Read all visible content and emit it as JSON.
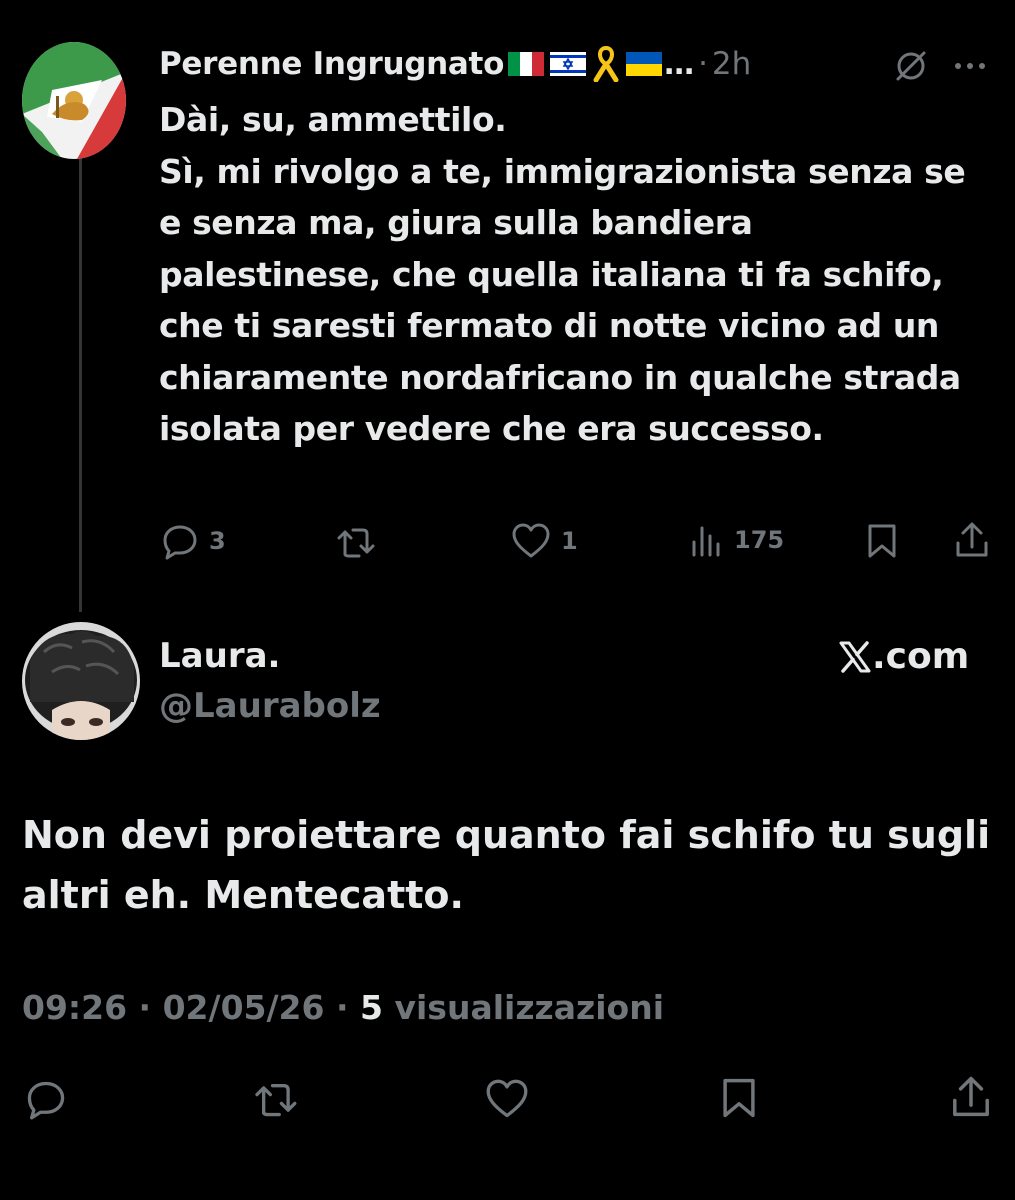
{
  "parent": {
    "author_name": "Perenne Ingrugnato",
    "name_ellipsis": "…",
    "separator": "·",
    "time": "2h",
    "body": "Dài, su, ammettilo.\nSì, mi rivolgo a te, immigrazionista senza se e senza ma, giura sulla bandiera palestinese, che quella italiana ti fa schifo, che ti saresti fermato di notte vicino ad un chiaramente nordafricano in qualche strada isolata per vedere che era successo.",
    "actions": {
      "replies": "3",
      "retweets": "",
      "likes": "1",
      "views": "175"
    },
    "icons": [
      "grok-icon",
      "more-icon",
      "reply-icon",
      "retweet-icon",
      "like-icon",
      "views-icon",
      "bookmark-icon",
      "share-icon"
    ]
  },
  "reply": {
    "author_name": "Laura.",
    "handle": "@Laurabolz",
    "source": ".com",
    "body": "Non devi proiettare quanto fai schifo tu sugli altri eh. Mentecatto.",
    "time": "09:26",
    "sep1": "·",
    "date": "02/05/26",
    "sep2": "·",
    "view_count": "5",
    "view_label": "visualizzazioni"
  },
  "colors": {
    "background": "#000000",
    "text_primary": "#e7e9ea",
    "text_secondary": "#71767b",
    "divider": "#333639"
  }
}
